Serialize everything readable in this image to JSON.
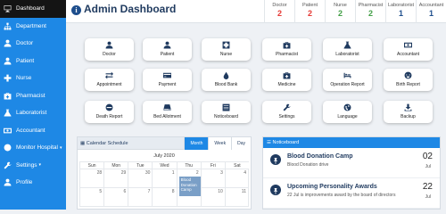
{
  "sidebar": {
    "items": [
      {
        "label": "Dashboard",
        "icon": "monitor-icon"
      },
      {
        "label": "Department",
        "icon": "hierarchy-icon"
      },
      {
        "label": "Doctor",
        "icon": "user-doctor-icon"
      },
      {
        "label": "Patient",
        "icon": "user-icon"
      },
      {
        "label": "Nurse",
        "icon": "plus-icon"
      },
      {
        "label": "Pharmacist",
        "icon": "medkit-icon"
      },
      {
        "label": "Laboratorist",
        "icon": "flask-icon"
      },
      {
        "label": "Accountant",
        "icon": "money-icon"
      },
      {
        "label": "Monitor Hospital",
        "icon": "globe-icon"
      },
      {
        "label": "Settings",
        "icon": "wrench-icon"
      },
      {
        "label": "Profile",
        "icon": "user-icon"
      }
    ]
  },
  "header": {
    "title": "Admin Dashboard",
    "stats": [
      {
        "label": "Doctor",
        "value": "2",
        "color": "#e53935"
      },
      {
        "label": "Patient",
        "value": "2",
        "color": "#e53935"
      },
      {
        "label": "Nurse",
        "value": "2",
        "color": "#43a047"
      },
      {
        "label": "Pharmacist",
        "value": "2",
        "color": "#43a047"
      },
      {
        "label": "Laboratorist",
        "value": "1",
        "color": "#1e4e8c"
      },
      {
        "label": "Accountant",
        "value": "1",
        "color": "#1e4e8c"
      }
    ]
  },
  "tiles": [
    {
      "label": "Doctor",
      "icon": "user-doctor-icon"
    },
    {
      "label": "Patient",
      "icon": "user-icon"
    },
    {
      "label": "Nurse",
      "icon": "plus-icon"
    },
    {
      "label": "Pharmacist",
      "icon": "medkit-icon"
    },
    {
      "label": "Laboratorist",
      "icon": "flask-icon"
    },
    {
      "label": "Accountant",
      "icon": "money-icon"
    },
    {
      "label": "Appointment",
      "icon": "exchange-icon"
    },
    {
      "label": "Payment",
      "icon": "credit-card-icon"
    },
    {
      "label": "Blood Bank",
      "icon": "drop-icon"
    },
    {
      "label": "Medicine",
      "icon": "medkit-icon"
    },
    {
      "label": "Operation Report",
      "icon": "hospital-bed-icon"
    },
    {
      "label": "Birth Report",
      "icon": "baby-icon"
    },
    {
      "label": "Death Report",
      "icon": "minus-circle-icon"
    },
    {
      "label": "Bed Allotment",
      "icon": "hdd-icon"
    },
    {
      "label": "Noticeboard",
      "icon": "list-icon"
    },
    {
      "label": "Settings",
      "icon": "wrench-icon"
    },
    {
      "label": "Language",
      "icon": "globe-icon"
    },
    {
      "label": "Backup",
      "icon": "download-icon"
    }
  ],
  "calendar": {
    "title": "Calendar Schedule",
    "views": [
      "Month",
      "Week",
      "Day"
    ],
    "active_view": "Month",
    "month_label": "July 2020",
    "weekdays": [
      "Sun",
      "Mon",
      "Tue",
      "Wed",
      "Thu",
      "Fri",
      "Sat"
    ],
    "days": [
      "28",
      "29",
      "30",
      "1",
      "2",
      "3",
      "4",
      "5",
      "6",
      "7",
      "8",
      "9",
      "10",
      "11"
    ],
    "event": {
      "text": "Blood Donation Camp",
      "day": "2"
    }
  },
  "noticeboard": {
    "title": "Noticeboard",
    "notices": [
      {
        "title": "Blood Donation Camp",
        "subtitle": "Blood Donation drive",
        "day": "02",
        "month": "Jul"
      },
      {
        "title": "Upcoming Personality Awards",
        "subtitle": "22 Jul is improvements award by the board of directors",
        "day": "22",
        "month": "Jul"
      }
    ]
  }
}
